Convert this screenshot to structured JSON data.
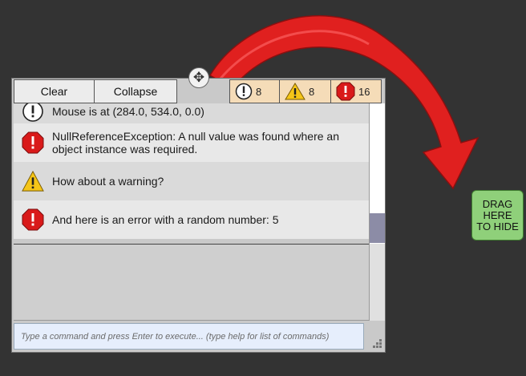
{
  "toolbar": {
    "clear_label": "Clear",
    "collapse_label": "Collapse"
  },
  "counters": {
    "info_count": "8",
    "warning_count": "8",
    "error_count": "16"
  },
  "logs": [
    {
      "type": "info",
      "icon": "info-icon",
      "text": "Mouse is at (284.0, 534.0, 0.0)"
    },
    {
      "type": "error",
      "icon": "error-icon",
      "text": "NullReferenceException: A null value was found where an object instance was required."
    },
    {
      "type": "warning",
      "icon": "warning-icon",
      "text": "How about a warning?"
    },
    {
      "type": "error",
      "icon": "error-icon",
      "text": "And here is an error with a random number: 5"
    }
  ],
  "command": {
    "placeholder": "Type a command and press Enter to execute... (type help for list of commands)",
    "value": ""
  },
  "hide_zone": {
    "label": "DRAG\nHERE\nTO HIDE"
  },
  "colors": {
    "background": "#333333",
    "arrow": "#e0201f",
    "counter_bg": "#f5dcb8",
    "hide_zone_bg": "#8fd07a",
    "scroll_thumb": "#8c8ca6"
  }
}
